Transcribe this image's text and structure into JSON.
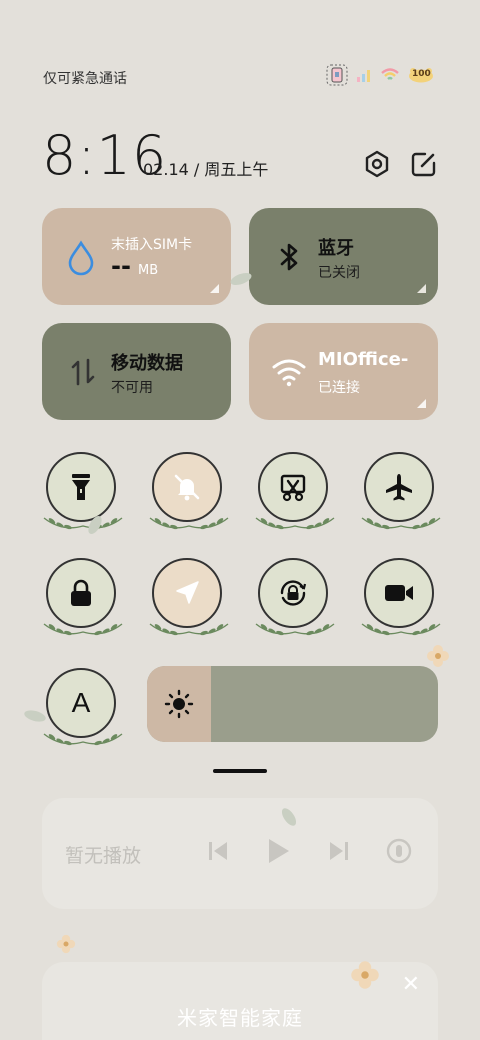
{
  "status": {
    "carrier": "仅可紧急通话",
    "battery": "100"
  },
  "header": {
    "time": "8:16",
    "date": "02.14 / 周五上午"
  },
  "tiles": {
    "data": {
      "title": "末插入SIM卡",
      "value": "--",
      "unit": "MB"
    },
    "bluetooth": {
      "title": "蓝牙",
      "status": "已关闭"
    },
    "mobile": {
      "title": "移动数据",
      "status": "不可用"
    },
    "wifi": {
      "title": "MIOffice-",
      "status": "已连接"
    }
  },
  "toggles": {
    "auto_brightness_label": "A"
  },
  "media": {
    "label": "暂无播放"
  },
  "home": {
    "title": "米家智能家庭"
  },
  "colors": {
    "beige": "#cdb8a5",
    "green": "#7a806b",
    "background": "#e3e0da"
  }
}
